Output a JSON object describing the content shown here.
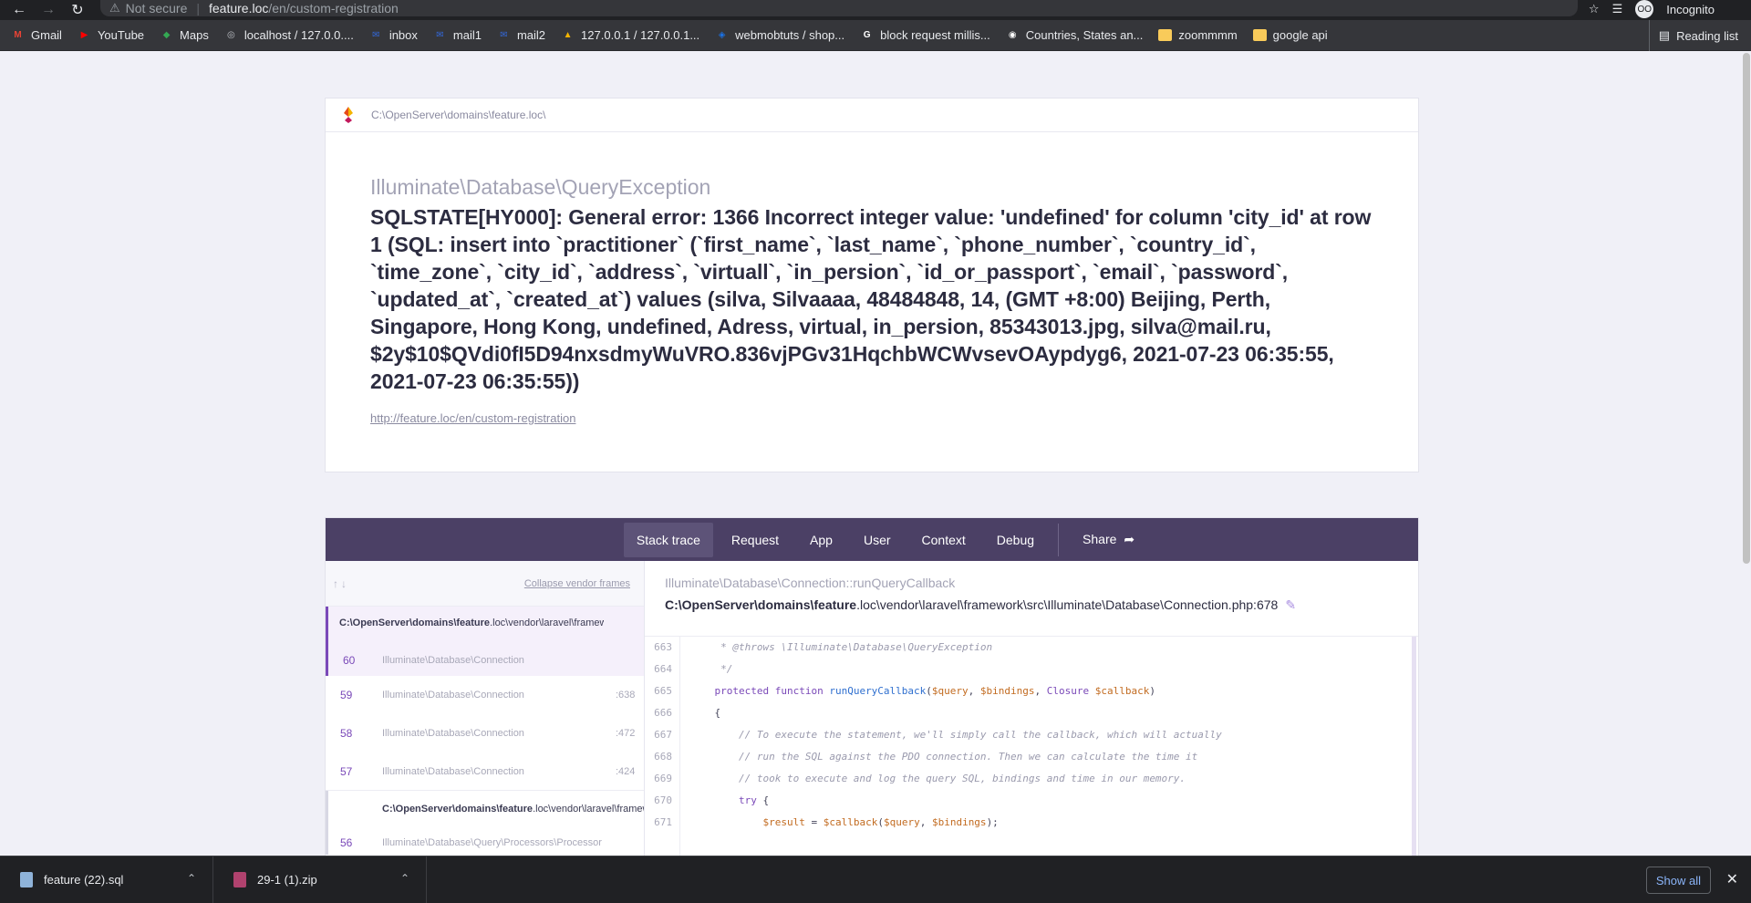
{
  "browser": {
    "not_secure": "Not secure",
    "url_host": "feature.loc",
    "url_path": "/en/custom-registration",
    "incognito": "Incognito",
    "avatar_text": "OO",
    "reading_list": "Reading list"
  },
  "bookmarks": [
    {
      "label": "Gmail",
      "color": "#ea4335",
      "icon": "M"
    },
    {
      "label": "YouTube",
      "color": "#ff0000",
      "icon": "▶"
    },
    {
      "label": "Maps",
      "color": "#34a853",
      "icon": "◆"
    },
    {
      "label": "localhost / 127.0.0....",
      "color": "#bdc1c6",
      "icon": "◎"
    },
    {
      "label": "inbox",
      "color": "#3367d6",
      "icon": "✉"
    },
    {
      "label": "mail1",
      "color": "#3367d6",
      "icon": "✉"
    },
    {
      "label": "mail2",
      "color": "#3367d6",
      "icon": "✉"
    },
    {
      "label": "127.0.0.1 / 127.0.0.1...",
      "color": "#f4b400",
      "icon": "▲"
    },
    {
      "label": "webmobtuts / shop...",
      "color": "#1a73e8",
      "icon": "◈"
    },
    {
      "label": "block request millis...",
      "color": "#ffffff",
      "icon": "G"
    },
    {
      "label": "Countries, States an...",
      "color": "#ffffff",
      "icon": "◉"
    },
    {
      "label": "zoommmm",
      "color": "#f9cb5a",
      "icon": ""
    },
    {
      "label": "google api",
      "color": "#f9cb5a",
      "icon": ""
    }
  ],
  "error": {
    "path": "C:\\OpenServer\\domains\\feature.loc\\",
    "exception_class": "Illuminate\\Database\\QueryException",
    "message": "SQLSTATE[HY000]: General error: 1366 Incorrect integer value: 'undefined' for column 'city_id' at row 1 (SQL: insert into `practitioner` (`first_name`, `last_name`, `phone_number`, `country_id`, `time_zone`, `city_id`, `address`, `virtuall`, `in_persion`, `id_or_passport`, `email`, `password`, `updated_at`, `created_at`) values (silva, Silvaaaa, 48484848, 14, (GMT +8:00) Beijing, Perth, Singapore, Hong Kong, undefined, Adress, virtual, in_persion, 85343013.jpg, silva@mail.ru, $2y$10$QVdi0fI5D94nxsdmyWuVRO.836vjPGv31HqchbWCWvsevOAypdyg6, 2021-07-23 06:35:55, 2021-07-23 06:35:55))",
    "url": "http://feature.loc/en/custom-registration"
  },
  "tabs": [
    "Stack trace",
    "Request",
    "App",
    "User",
    "Context",
    "Debug"
  ],
  "share_label": "Share",
  "frames_panel": {
    "collapse_label": "Collapse vendor frames",
    "group1_file_strong": "C:\\OpenServer\\domains\\feature",
    "group1_file_rest": ".loc\\vendor\\laravel\\framework\\src\\Illuminate\\Database\\Connection.php",
    "group1_rows": [
      {
        "num": "60",
        "cls": "Illuminate\\Database\\Connection",
        "line": ""
      },
      {
        "num": "59",
        "cls": "Illuminate\\Database\\Connection",
        "line": ":638"
      },
      {
        "num": "58",
        "cls": "Illuminate\\Database\\Connection",
        "line": ":472"
      },
      {
        "num": "57",
        "cls": "Illuminate\\Database\\Connection",
        "line": ":424"
      }
    ],
    "group2_file_strong": "C:\\OpenServer\\domains\\feature",
    "group2_file_rest": ".loc\\vendor\\laravel\\framework\\src\\Illuminate\\Database\\Query\\Processors\\Processor.php",
    "group2_rows": [
      {
        "num": "56",
        "cls": "Illuminate\\Database\\Query\\Processors\\Processor",
        "line": ""
      }
    ]
  },
  "code": {
    "function": "Illuminate\\Database\\Connection::runQueryCallback",
    "path_strong_a": "C:\\OpenServer\\domains\\feature",
    "path_rest": ".loc\\vendor\\laravel\\framework\\src\\Illuminate\\Database\\Connection.php:678",
    "lines": [
      {
        "n": "663",
        "parts": [
          [
            "cmt",
            "     * @throws \\Illuminate\\Database\\QueryException"
          ]
        ]
      },
      {
        "n": "664",
        "parts": [
          [
            "cmt",
            "     */"
          ]
        ]
      },
      {
        "n": "665",
        "parts": [
          [
            "kw",
            "    protected function "
          ],
          [
            "fnn",
            "runQueryCallback"
          ],
          [
            "",
            "("
          ],
          [
            "var",
            "$query"
          ],
          [
            "",
            ", "
          ],
          [
            "var",
            "$bindings"
          ],
          [
            "",
            ", "
          ],
          [
            "kw",
            "Closure "
          ],
          [
            "var",
            "$callback"
          ],
          [
            "",
            ")"
          ]
        ]
      },
      {
        "n": "666",
        "parts": [
          [
            "",
            "    {"
          ]
        ]
      },
      {
        "n": "667",
        "parts": [
          [
            "cmt",
            "        // To execute the statement, we'll simply call the callback, which will actually"
          ]
        ]
      },
      {
        "n": "668",
        "parts": [
          [
            "cmt",
            "        // run the SQL against the PDO connection. Then we can calculate the time it"
          ]
        ]
      },
      {
        "n": "669",
        "parts": [
          [
            "cmt",
            "        // took to execute and log the query SQL, bindings and time in our memory."
          ]
        ]
      },
      {
        "n": "670",
        "parts": [
          [
            "kw",
            "        try "
          ],
          [
            "",
            "{"
          ]
        ]
      },
      {
        "n": "671",
        "parts": [
          [
            "var",
            "            $result"
          ],
          [
            "",
            " = "
          ],
          [
            "var",
            "$callback"
          ],
          [
            "",
            "("
          ],
          [
            "var",
            "$query"
          ],
          [
            "",
            ", "
          ],
          [
            "var",
            "$bindings"
          ],
          [
            "",
            ");"
          ]
        ]
      }
    ]
  },
  "downloads": [
    {
      "name": "feature (22).sql",
      "color": "#8fb3d9"
    },
    {
      "name": "29-1 (1).zip",
      "color": "#b0426e"
    }
  ],
  "show_all": "Show all"
}
